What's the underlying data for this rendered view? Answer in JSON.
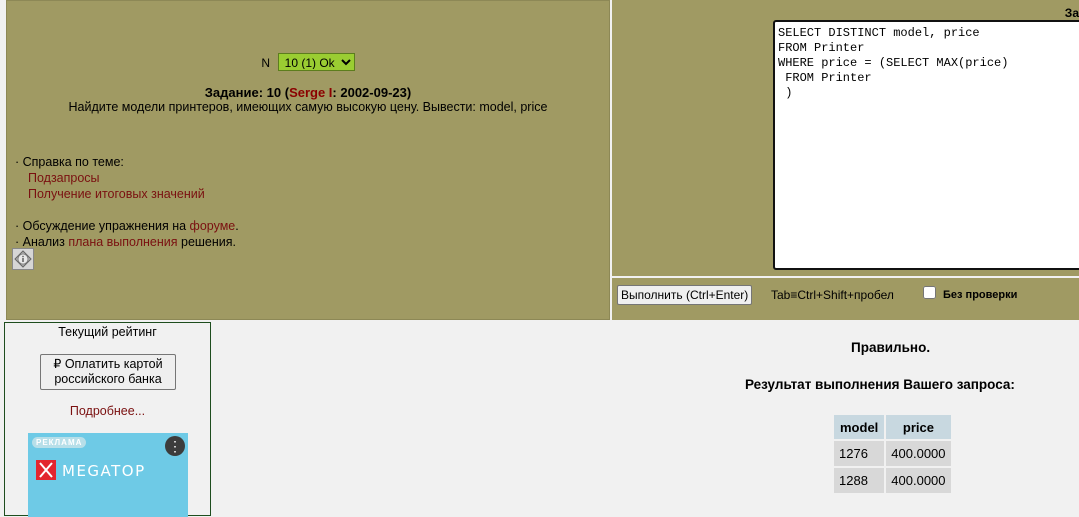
{
  "task": {
    "n_label": "N",
    "selected_option": "10 (1) Ok",
    "title_prefix": "Задание: 10 (",
    "author": "Serge I",
    "title_suffix": ": 2002-09-23)",
    "description": "Найдите модели принтеров, имеющих самую высокую цену. Вывести: model, price"
  },
  "help": {
    "topic_label": "· Справка по теме:",
    "links": [
      "Подзапросы",
      "Получение итоговых значений"
    ],
    "forum_prefix": "· Обсуждение упражнения на ",
    "forum_link": "форуме",
    "forum_suffix": ".",
    "plan_prefix": "· Анализ ",
    "plan_link": "плана выполнения",
    "plan_suffix": " решения."
  },
  "editor": {
    "label": "За",
    "query": "SELECT DISTINCT model, price\nFROM Printer\nWHERE price = (SELECT MAX(price)\n FROM Printer\n )"
  },
  "run_bar": {
    "run_button": "Выполнить (Ctrl+Enter)",
    "tab_hint": "Tab≡Ctrl+Shift+пробел",
    "no_check_label": "Без проверки"
  },
  "rating": {
    "title": "Текущий рейтинг",
    "pay_button": "₽ Оплатить картой российского банка",
    "more_link": "Подробнее..."
  },
  "ad": {
    "badge": "РЕКЛАМА",
    "brand": "MEGATOP",
    "colors": {
      "background": "#6ecae6",
      "logo": "#ffffff",
      "mark": "#e3262e"
    }
  },
  "result": {
    "status": "Правильно.",
    "title": "Результат выполнения Вашего запроса:",
    "columns": [
      "model",
      "price"
    ],
    "rows": [
      [
        "1276",
        "400.0000"
      ],
      [
        "1288",
        "400.0000"
      ]
    ]
  },
  "colors": {
    "panel": "#a09a63",
    "select_bg": "#9acd32",
    "link": "#7a1010",
    "table_header": "#c8d8e0",
    "table_cell": "#d8d8d8"
  }
}
